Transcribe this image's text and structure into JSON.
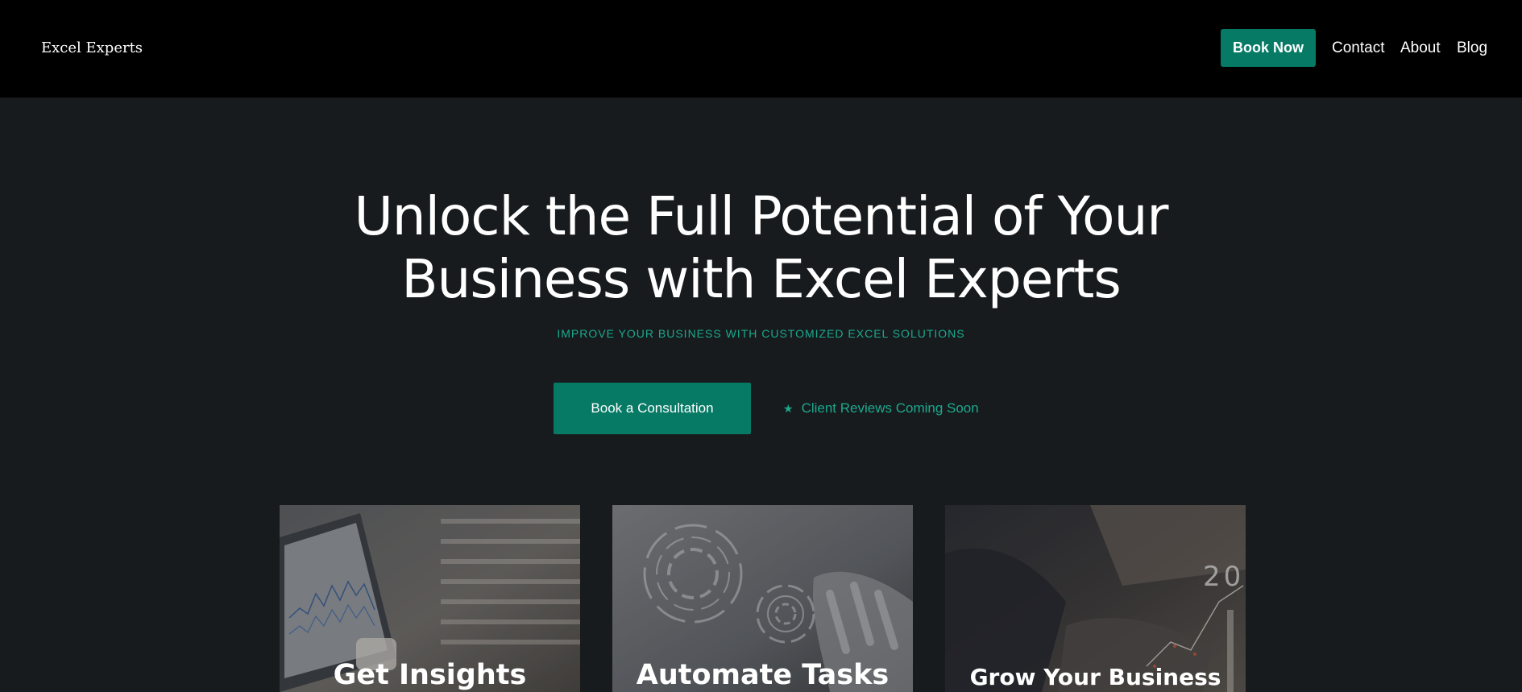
{
  "header": {
    "logo_text": "Excel Experts",
    "book_now_label": "Book Now",
    "nav": {
      "contact": "Contact",
      "about": "About",
      "blog": "Blog"
    }
  },
  "hero": {
    "title_line1": "Unlock the Full Potential of Your",
    "title_line2": "Business with Excel Experts",
    "subtitle": "IMPROVE YOUR BUSINESS WITH CUSTOMIZED EXCEL SOLUTIONS",
    "cta_label": "Book a Consultation",
    "reviews_icon": "star-icon",
    "reviews_text": "Client Reviews Coming Soon"
  },
  "cards": [
    {
      "title": "Get Insights"
    },
    {
      "title": "Automate Tasks"
    },
    {
      "title": "Grow Your Business"
    }
  ],
  "colors": {
    "header_bg": "#000000",
    "page_bg": "#171b1e",
    "accent": "#077a66",
    "accent_text": "#1ba98d",
    "text": "#ffffff"
  }
}
